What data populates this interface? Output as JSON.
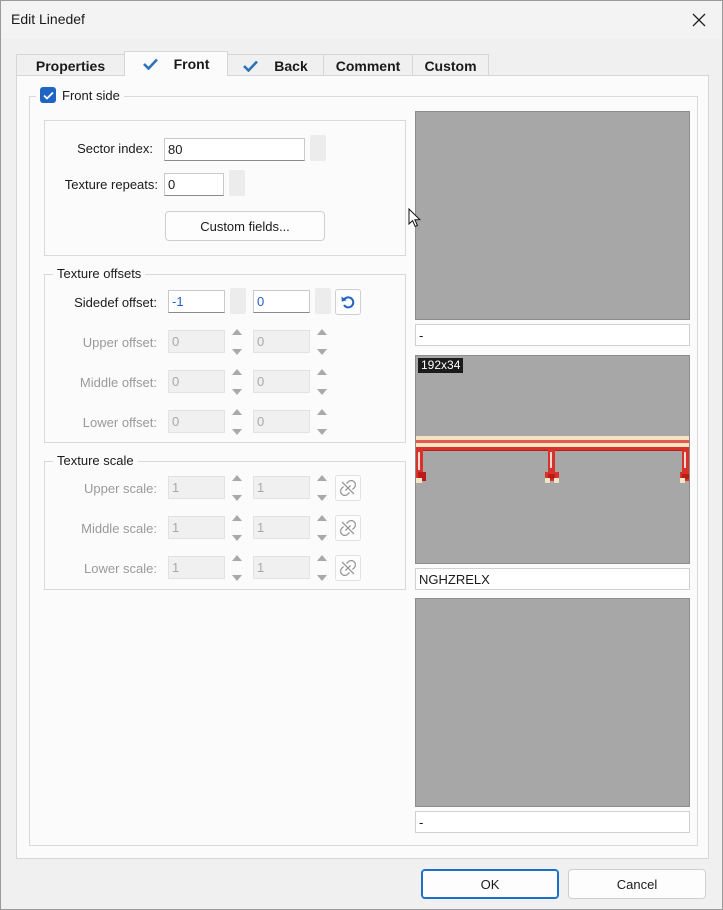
{
  "window": {
    "title": "Edit Linedef"
  },
  "tabs": [
    {
      "label": "Properties",
      "checked": false
    },
    {
      "label": "Front",
      "checked": true
    },
    {
      "label": "Back",
      "checked": true
    },
    {
      "label": "Comment",
      "checked": false
    },
    {
      "label": "Custom",
      "checked": false
    }
  ],
  "front_side": {
    "label": "Front side",
    "checked": true
  },
  "sector": {
    "sector_index_label": "Sector index:",
    "sector_index_value": "80",
    "texture_repeats_label": "Texture repeats:",
    "texture_repeats_value": "0",
    "custom_fields_button": "Custom fields..."
  },
  "offsets": {
    "group_title": "Texture offsets",
    "sidedef_label": "Sidedef offset:",
    "sidedef_x": "-1",
    "sidedef_y": "0",
    "upper_label": "Upper offset:",
    "upper_x": "0",
    "upper_y": "0",
    "middle_label": "Middle offset:",
    "middle_x": "0",
    "middle_y": "0",
    "lower_label": "Lower offset:",
    "lower_x": "0",
    "lower_y": "0"
  },
  "scale": {
    "group_title": "Texture scale",
    "upper_label": "Upper scale:",
    "upper_x": "1",
    "upper_y": "1",
    "middle_label": "Middle scale:",
    "middle_x": "1",
    "middle_y": "1",
    "lower_label": "Lower scale:",
    "lower_x": "1",
    "lower_y": "1"
  },
  "textures": {
    "upper_name": "-",
    "middle_size": "192x34",
    "middle_name": "NGHZRELX",
    "lower_name": "-"
  },
  "footer": {
    "ok_label": "OK",
    "cancel_label": "Cancel"
  },
  "colors": {
    "accent": "#1f63c4",
    "preview_bg": "#a7a7a7",
    "texture_red": "#d8322a",
    "texture_cream": "#f6e3c3"
  }
}
